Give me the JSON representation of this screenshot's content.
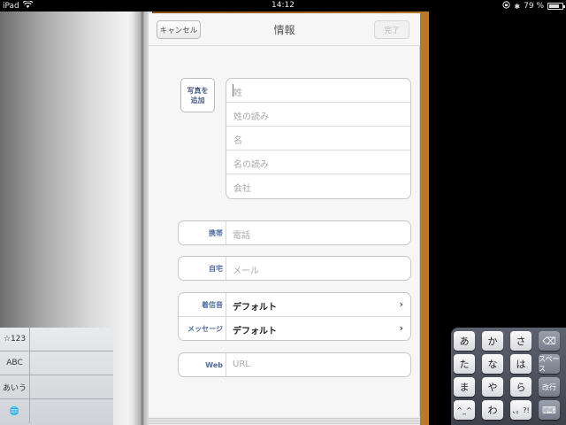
{
  "status_bar": {
    "device": "iPad",
    "time": "14:12",
    "battery_text": "79 %",
    "battery_level": 0.79
  },
  "nav": {
    "cancel_label": "キャンセル",
    "title": "情報",
    "done_label": "完了"
  },
  "photo_button_label": "写真を\n追加",
  "name_fields": [
    "姓",
    "姓の読み",
    "名",
    "名の読み",
    "会社"
  ],
  "phone": {
    "label": "携帯",
    "placeholder": "電話"
  },
  "email": {
    "label": "自宅",
    "placeholder": "メール"
  },
  "tones": [
    {
      "label": "着信音",
      "value": "デフォルト"
    },
    {
      "label": "メッセージ",
      "value": "デフォルト"
    }
  ],
  "web": {
    "label": "Web",
    "placeholder": "URL"
  },
  "keyboard_left": [
    "☆123",
    "ABC",
    "あいう",
    "🌐"
  ],
  "keyboard_right": {
    "row1": [
      "あ",
      "か",
      "さ",
      "⌫"
    ],
    "row2": [
      "た",
      "な",
      "は",
      "スペース"
    ],
    "row3": [
      "ま",
      "や",
      "ら",
      "改行"
    ],
    "row4": [
      "^_^",
      "わ",
      "、。?!",
      "⌨"
    ]
  },
  "colors": {
    "label_blue": "#506ba5",
    "placeholder_gray": "#a8a8a8",
    "book_brown": "#9a5e1d"
  }
}
